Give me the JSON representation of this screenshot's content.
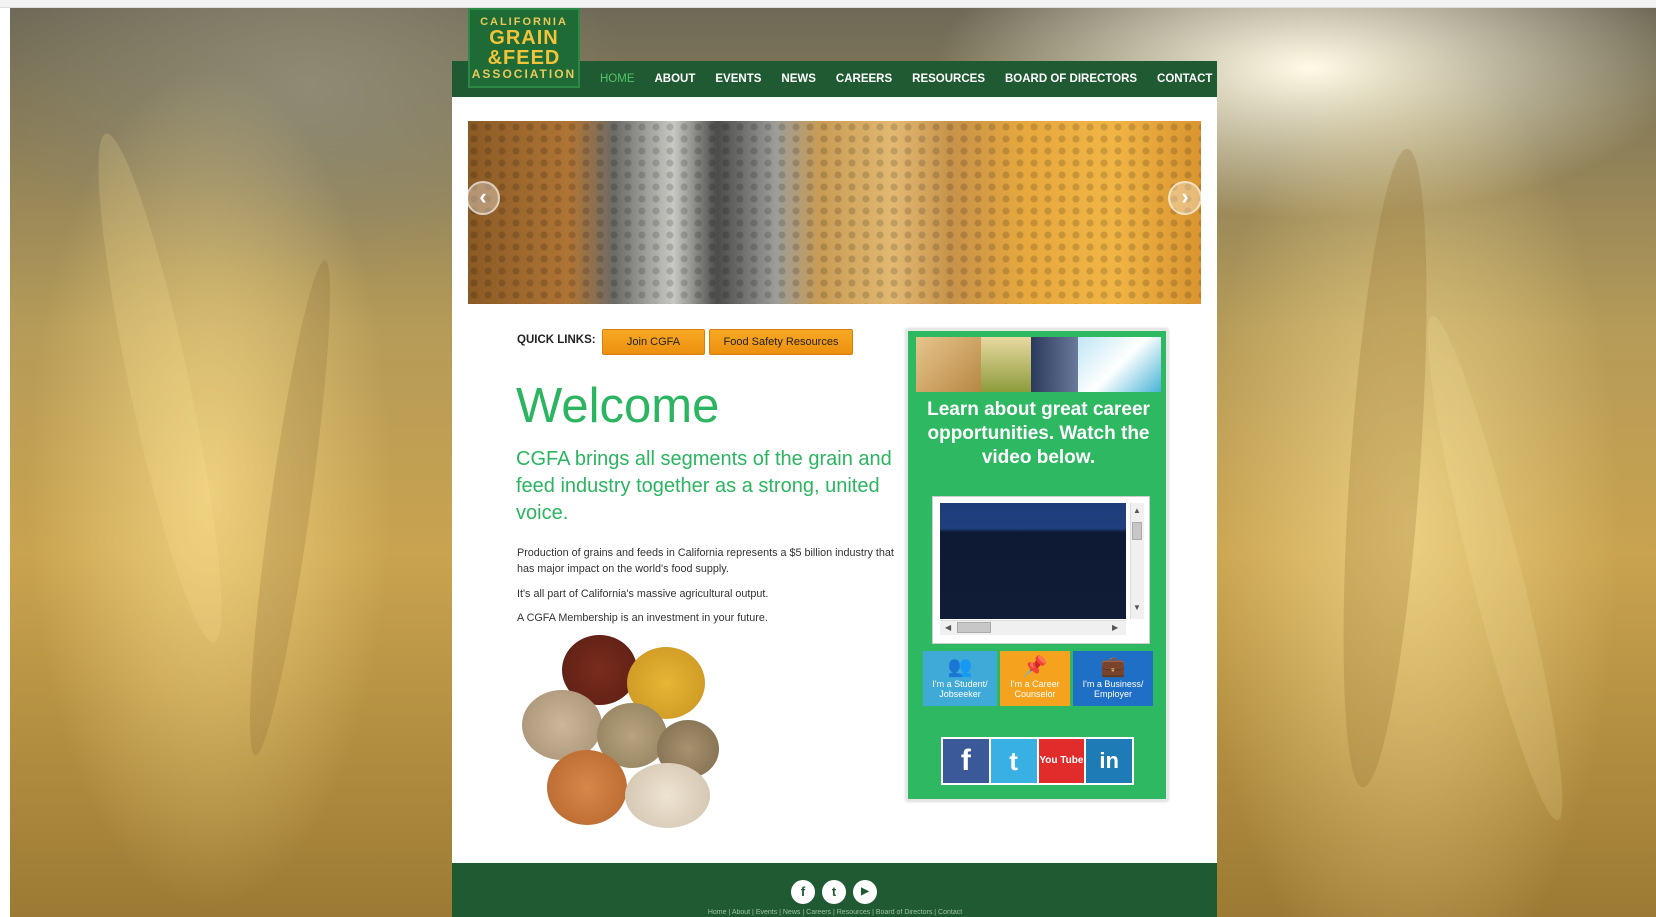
{
  "logo": {
    "line1": "CALIFORNIA",
    "line2": "GRAIN",
    "line3": "&FEED",
    "line4": "ASSOCIATION"
  },
  "nav": {
    "items": [
      {
        "label": "HOME",
        "active": true
      },
      {
        "label": "ABOUT"
      },
      {
        "label": "EVENTS"
      },
      {
        "label": "NEWS"
      },
      {
        "label": "CAREERS"
      },
      {
        "label": "RESOURCES"
      },
      {
        "label": "BOARD OF DIRECTORS"
      },
      {
        "label": "CONTACT"
      }
    ]
  },
  "carousel": {
    "prev_icon": "chevron-left-icon",
    "next_icon": "chevron-right-icon",
    "prev_glyph": "‹",
    "next_glyph": "›"
  },
  "quick_links": {
    "label": "QUICK LINKS:",
    "join": "Join CGFA",
    "food_safety": "Food Safety Resources"
  },
  "main": {
    "heading": "Welcome",
    "tagline": "CGFA brings all segments of the grain and feed industry together as a strong, united voice.",
    "p1": "Production of grains and feeds in California represents a $5 billion industry that has major impact on the world's food supply.",
    "p2": "It's all part of California's massive agricultural output.",
    "p3": "A CGFA Membership is an investment in your future."
  },
  "sidebar": {
    "title": "Learn about great career opportunities. Watch the video below.",
    "roles": [
      {
        "label": "I'm a Student/ Jobseeker",
        "icon": "users-icon",
        "glyph": "👥",
        "color": "#3fa9d8"
      },
      {
        "label": "I'm a Career Counselor",
        "icon": "pushpin-icon",
        "glyph": "📌",
        "color": "#f5a21e"
      },
      {
        "label": "I'm a Business/ Employer",
        "icon": "briefcase-icon",
        "glyph": "💼",
        "color": "#1f6fc6"
      }
    ],
    "social": [
      {
        "name": "facebook-icon",
        "glyph": "f",
        "color": "#3b5998"
      },
      {
        "name": "twitter-icon",
        "glyph": "t",
        "color": "#38b0e3"
      },
      {
        "name": "youtube-icon",
        "glyph": "You Tube",
        "color": "#e22c2c"
      },
      {
        "name": "linkedin-icon",
        "glyph": "in",
        "color": "#1f7bb6"
      }
    ]
  },
  "footer": {
    "icons": [
      {
        "name": "facebook-icon",
        "glyph": "f"
      },
      {
        "name": "twitter-icon",
        "glyph": "t"
      },
      {
        "name": "youtube-icon",
        "glyph": "▶"
      }
    ],
    "links": "Home | About | Events | News | Careers | Resources | Board of Directors | Contact"
  },
  "colors": {
    "header_green": "#1f5a32",
    "accent_green": "#2bb560",
    "button_orange": "#f8a924"
  }
}
